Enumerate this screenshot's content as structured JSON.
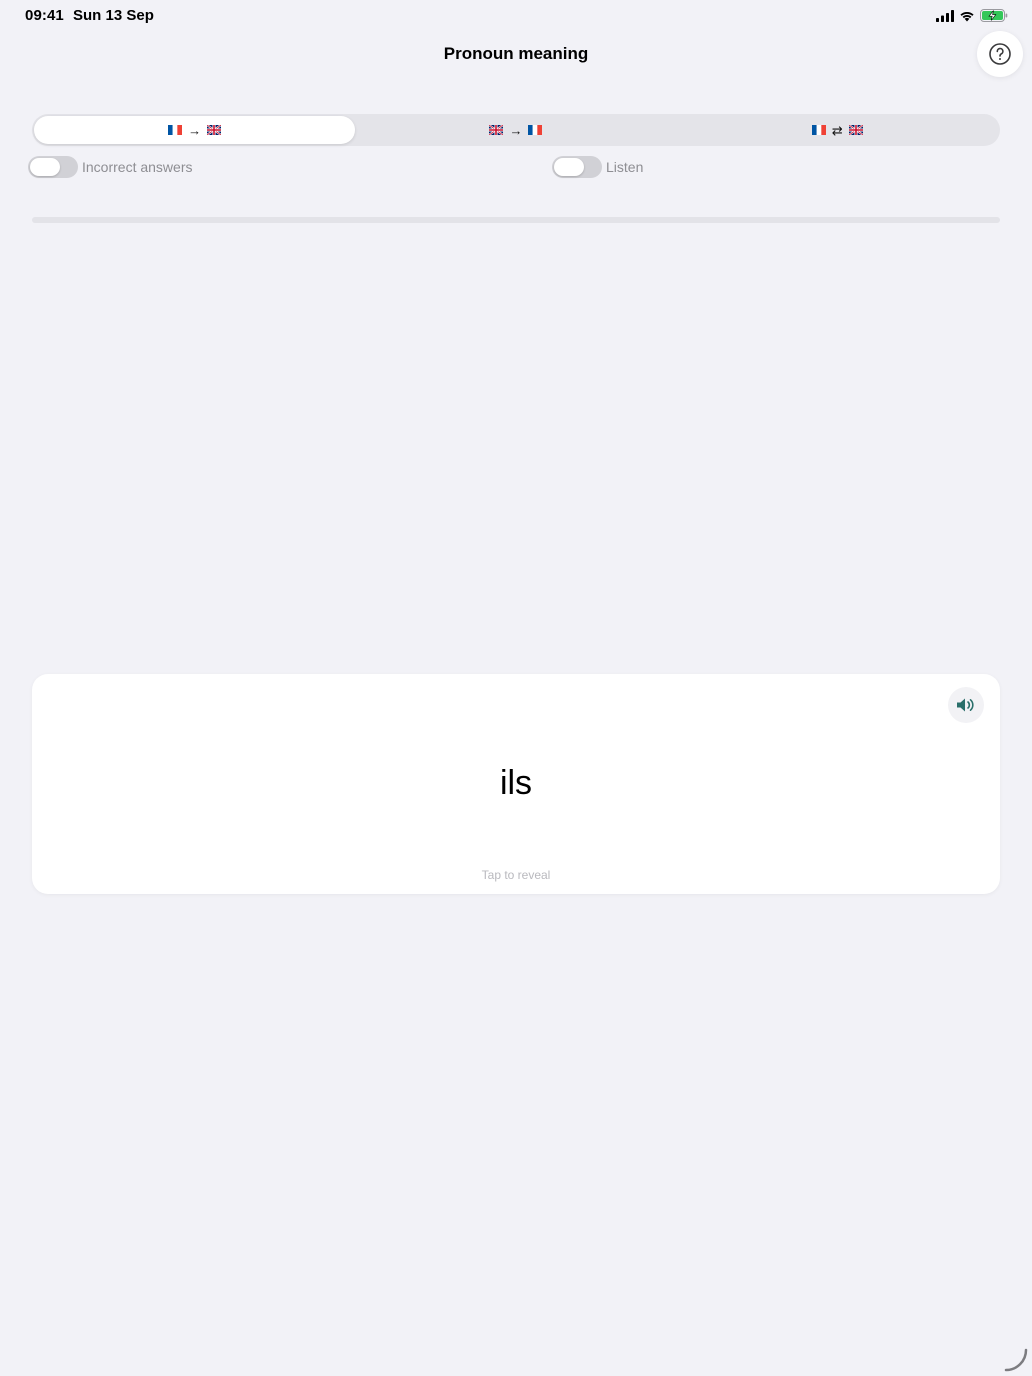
{
  "status_bar": {
    "time": "09:41",
    "date": "Sun 13 Sep",
    "icons": [
      "signal-icon",
      "wifi-icon",
      "battery-charging-icon"
    ],
    "battery_color": "#34c759"
  },
  "header": {
    "title": "Pronoun meaning",
    "help_icon": "question-circle-icon"
  },
  "direction_tabs": [
    {
      "from": "fr-flag",
      "arrow": "→",
      "to": "uk-flag",
      "selected": true
    },
    {
      "from": "uk-flag",
      "arrow": "→",
      "to": "fr-flag",
      "selected": false
    },
    {
      "from": "fr-flag",
      "arrow": "⇄",
      "to": "uk-flag",
      "selected": false
    }
  ],
  "toggles": {
    "incorrect_answers": {
      "label": "Incorrect answers",
      "on": false
    },
    "listen": {
      "label": "Listen",
      "on": false
    }
  },
  "progress": {
    "value": 0
  },
  "card": {
    "word": "ils",
    "hint": "Tap to reveal",
    "speaker_icon": "speaker-icon",
    "speaker_color": "#2a6f6a"
  }
}
